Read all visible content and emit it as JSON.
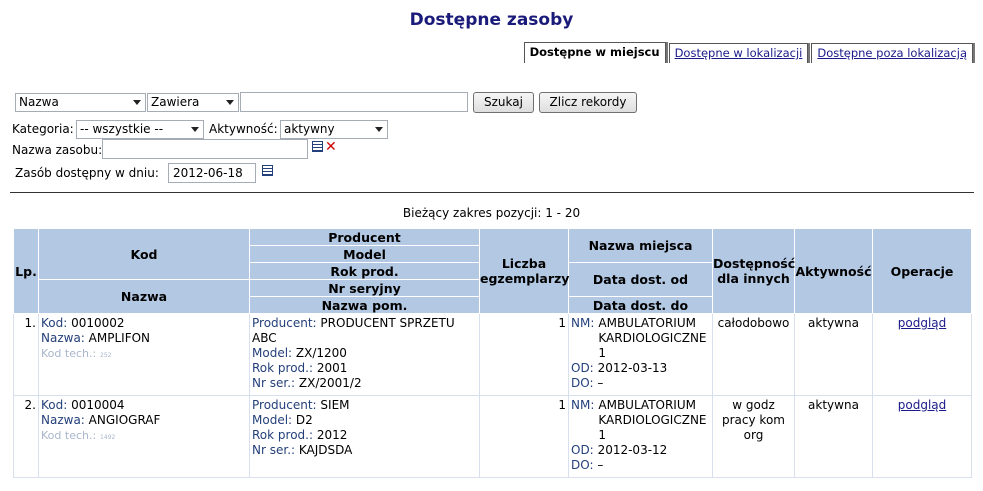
{
  "title": "Dostępne zasoby",
  "tabs": [
    {
      "label": "Dostępne w miejscu"
    },
    {
      "label": "Dostępne w lokalizacji"
    },
    {
      "label": "Dostępne poza lokalizacją"
    }
  ],
  "search": {
    "field_select": "Nazwa",
    "mode_select": "Zawiera",
    "value": "",
    "search_button": "Szukaj",
    "count_button": "Zlicz rekordy"
  },
  "filters": {
    "kategoria_label": "Kategoria:",
    "kategoria_value": "-- wszystkie --",
    "aktywnosc_label": "Aktywność:",
    "aktywnosc_value": "aktywny",
    "nazwa_label": "Nazwa zasobu:",
    "nazwa_value": "",
    "date_label": "Zasób dostępny w dniu:",
    "date_value": "2012-06-18"
  },
  "range_text": "Bieżący zakres pozycji: 1 - 20",
  "table": {
    "headers": {
      "lp": "Lp.",
      "kod": "Kod",
      "nazwa": "Nazwa",
      "producent": "Producent",
      "model": "Model",
      "rok": "Rok prod.",
      "nr": "Nr seryjny",
      "nazwa_pom": "Nazwa pom.",
      "liczba": "Liczba egzemplarzy",
      "miejsce": "Nazwa miejsca",
      "data_od": "Data dost. od",
      "data_do": "Data dost. do",
      "dostepnosc": "Dostępność dla innych",
      "aktywnosc": "Aktywność",
      "operacje": "Operacje"
    },
    "keys": {
      "kod": "Kod:",
      "nazwa": "Nazwa:",
      "kod_tech": "Kod tech.:",
      "producent": "Producent:",
      "model": "Model:",
      "rok": "Rok prod.:",
      "nr": "Nr ser.:",
      "nm": "NM:",
      "od": "OD:",
      "do": "DO:"
    },
    "rows": [
      {
        "lp": "1.",
        "kod": "0010002",
        "nazwa": "AMPLIFON",
        "kod_tech": "252",
        "producent": "PRODUCENT SPRZETU ABC",
        "model": "ZX/1200",
        "rok": "2001",
        "nr": "ZX/2001/2",
        "liczba": "1",
        "miejsce": "AMBULATORIUM KARDIOLOGICZNE 1",
        "od": "2012-03-13",
        "do": "–",
        "dostepnosc": "całodobowo",
        "aktywnosc": "aktywna",
        "operacje": "podgląd"
      },
      {
        "lp": "2.",
        "kod": "0010004",
        "nazwa": "ANGIOGRAF",
        "kod_tech": "1492",
        "producent": "SIEM",
        "model": "D2",
        "rok": "2012",
        "nr": "KAJDSDA",
        "liczba": "1",
        "miejsce": "AMBULATORIUM KARDIOLOGICZNE 1",
        "od": "2012-03-12",
        "do": "–",
        "dostepnosc": "w godz pracy kom org",
        "aktywnosc": "aktywna",
        "operacje": "podgląd"
      }
    ]
  }
}
